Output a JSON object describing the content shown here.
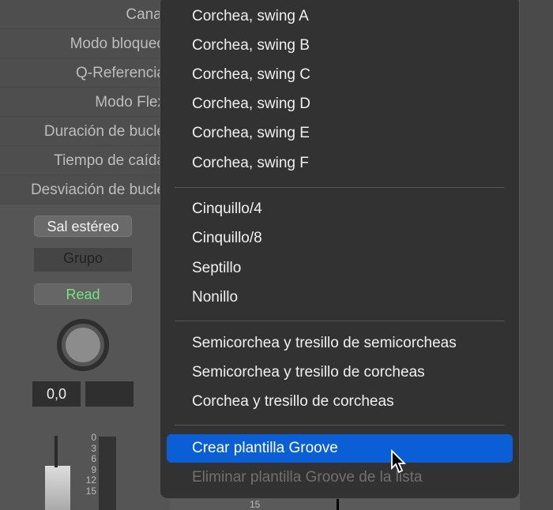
{
  "inspector": {
    "rows": [
      "Canal",
      "Modo bloqueo",
      "Q-Referencia",
      "Modo Flex",
      "Duración de bucle",
      "Tiempo de caída",
      "Desviación de bucle"
    ]
  },
  "strip": {
    "output": "Sal estéreo",
    "group": "Grupo",
    "automation": "Read",
    "pan_value": "0,0",
    "meter_ticks": [
      "0",
      "3",
      "6",
      "9",
      "12",
      "15"
    ],
    "meter_tick_bg": "15"
  },
  "menu": {
    "group1": [
      "Corchea, swing A",
      "Corchea, swing B",
      "Corchea, swing C",
      "Corchea, swing D",
      "Corchea, swing E",
      "Corchea, swing F"
    ],
    "group2": [
      "Cinquillo/4",
      "Cinquillo/8",
      "Septillo",
      "Nonillo"
    ],
    "group3": [
      "Semicorchea y tresillo de semicorcheas",
      "Semicorchea y tresillo de corcheas",
      "Corchea y tresillo de corcheas"
    ],
    "create": "Crear plantilla Groove",
    "remove": "Eliminar plantilla Groove de la lista"
  },
  "colors": {
    "highlight": "#0a5fd6",
    "read": "#6ee87a"
  }
}
